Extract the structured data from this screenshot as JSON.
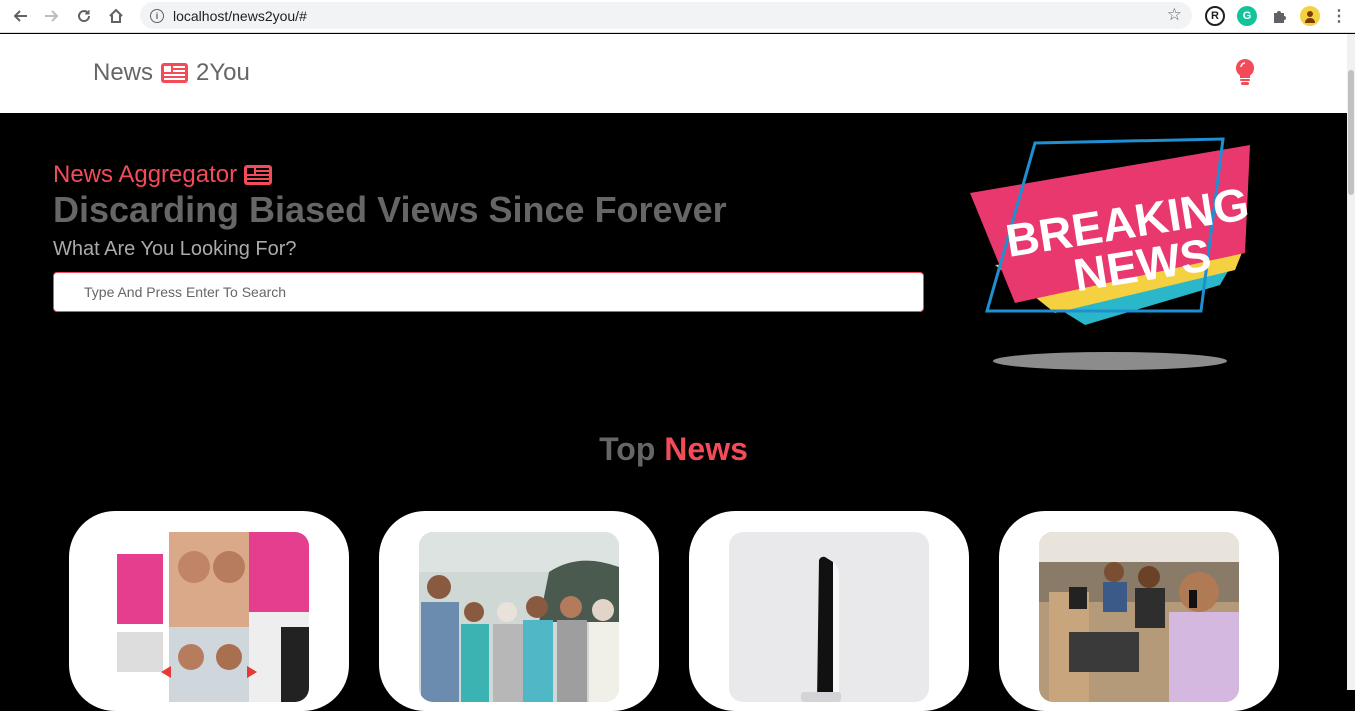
{
  "browser": {
    "url": "localhost/news2you/#",
    "extensions": {
      "r_label": "R",
      "g_label": "G"
    }
  },
  "navbar": {
    "brand_left": "News",
    "brand_right": "2You",
    "brand_icon": "newspaper-icon",
    "action_icon": "lightbulb-icon"
  },
  "hero": {
    "kicker": "News Aggregator",
    "tagline": "Discarding Biased Views Since Forever",
    "prompt": "What Are You Looking For?",
    "search_placeholder": "Type And Press Enter To Search",
    "banner_line1": "BREAKING",
    "banner_line2": "NEWS"
  },
  "section": {
    "title_part1": "Top",
    "title_part2": "News"
  },
  "colors": {
    "accent": "#f44b59",
    "muted_text": "#666666",
    "background": "#000000"
  },
  "cards": [
    {
      "image": "news-collage-thumbnail"
    },
    {
      "image": "group-photo-thumbnail"
    },
    {
      "image": "console-thumbnail"
    },
    {
      "image": "office-call-thumbnail"
    }
  ]
}
